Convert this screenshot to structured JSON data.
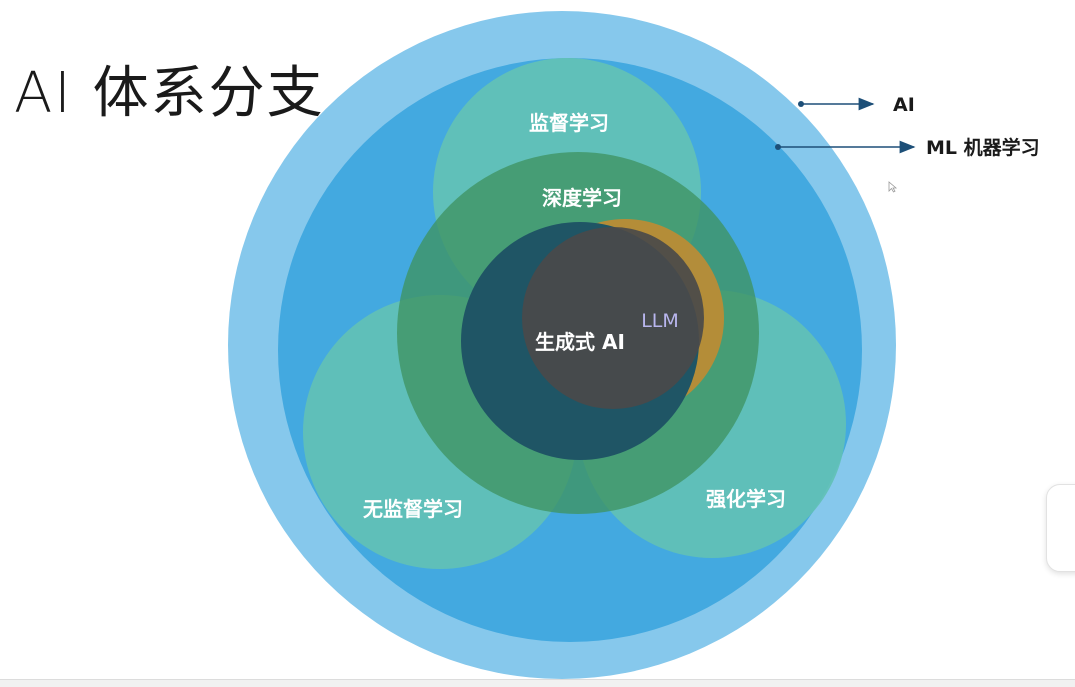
{
  "title": "AI 体系分支",
  "diagram": {
    "outer_labels": {
      "ai": "AI",
      "ml": "ML 机器学习"
    },
    "circles": {
      "supervised": "监督学习",
      "deep": "深度学习",
      "generative": "生成式 AI",
      "llm": "LLM",
      "unsupervised": "无监督学习",
      "reinforcement": "强化学习"
    }
  },
  "colors": {
    "ai": "#86c8ec",
    "ml": "#43a9e0",
    "teal": "#5fbfb8",
    "deep": "#4c9a6e",
    "generative": "#1f5565",
    "llm": "#4a4a4a",
    "llm_orange": "#c88b2e",
    "arrow": "#1d4f78"
  }
}
